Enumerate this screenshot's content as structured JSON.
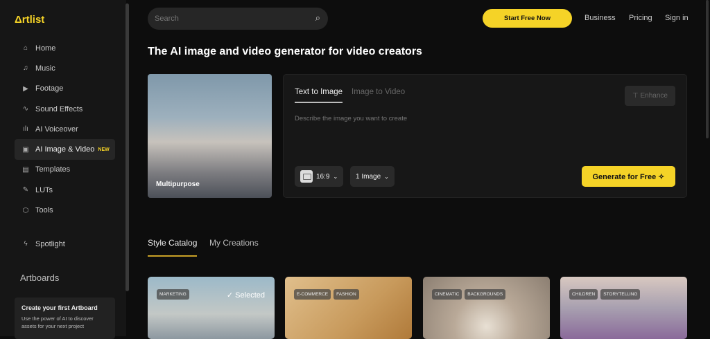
{
  "sidebar": {
    "logo": "Δrtlist",
    "items": [
      {
        "label": "Home",
        "icon": "⌂"
      },
      {
        "label": "Music",
        "icon": "♫"
      },
      {
        "label": "Footage",
        "icon": "▶"
      },
      {
        "label": "Sound Effects",
        "icon": "∿"
      },
      {
        "label": "AI Voiceover",
        "icon": "ılı"
      },
      {
        "label": "AI Image & Video",
        "icon": "▣",
        "badge": "NEW"
      },
      {
        "label": "Templates",
        "icon": "▤"
      },
      {
        "label": "LUTs",
        "icon": "✎"
      },
      {
        "label": "Tools",
        "icon": "⬡"
      }
    ],
    "spotlight": {
      "label": "Spotlight",
      "icon": "ϟ"
    },
    "artboards": "Artboards",
    "card": {
      "title": "Create your first Artboard",
      "text": "Use the power of AI to discover assets for your next project"
    }
  },
  "header": {
    "search_placeholder": "Search",
    "start": "Start Free Now",
    "links": [
      "Business",
      "Pricing",
      "Sign in"
    ]
  },
  "main": {
    "title": "The AI image and video generator for video creators",
    "hero_label": "Multipurpose",
    "tabs": [
      "Text to Image",
      "Image to Video"
    ],
    "enhance": "Enhance",
    "prompt_placeholder": "Describe the image you want to create",
    "ratio": "16:9",
    "count": "1 Image",
    "generate": "Generate for Free ✧",
    "style_tabs": [
      "Style Catalog",
      "My Creations"
    ],
    "styles": [
      {
        "tags": [
          "MARKETING"
        ],
        "selected": "✓ Selected"
      },
      {
        "tags": [
          "E-COMMERCE",
          "FASHION"
        ]
      },
      {
        "tags": [
          "CINEMATIC",
          "BACKGROUNDS"
        ]
      },
      {
        "tags": [
          "CHILDREN",
          "STORYTELLING"
        ]
      }
    ]
  }
}
